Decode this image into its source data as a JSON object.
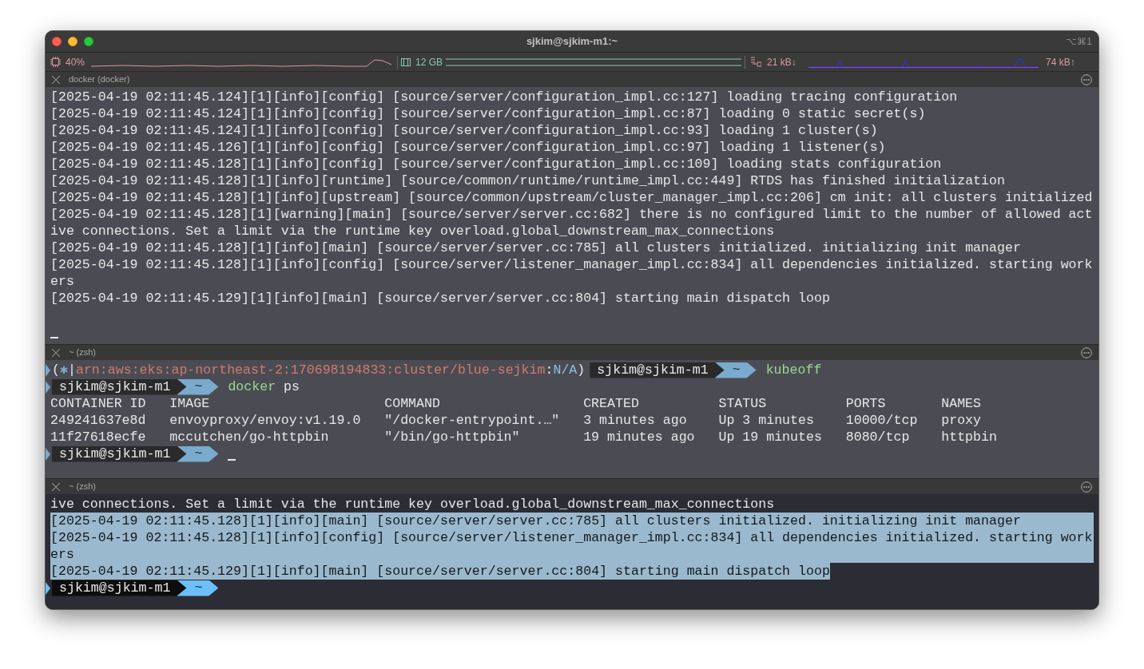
{
  "window": {
    "title": "sjkim@sjkim-m1:~",
    "shortcut": "⌥⌘1"
  },
  "status_bar": {
    "cpu": "40%",
    "memory": "12 GB",
    "download": "21 kB↓",
    "upload": "74 kB↑"
  },
  "panes": [
    {
      "title": "docker (docker)",
      "active": false,
      "lines": [
        {
          "kind": "text",
          "text": "[2025-04-19 02:11:45.124][1][info][config] [source/server/configuration_impl.cc:127] loading tracing configuration"
        },
        {
          "kind": "text",
          "text": "[2025-04-19 02:11:45.124][1][info][config] [source/server/configuration_impl.cc:87] loading 0 static secret(s)"
        },
        {
          "kind": "text",
          "text": "[2025-04-19 02:11:45.124][1][info][config] [source/server/configuration_impl.cc:93] loading 1 cluster(s)"
        },
        {
          "kind": "text",
          "text": "[2025-04-19 02:11:45.126][1][info][config] [source/server/configuration_impl.cc:97] loading 1 listener(s)"
        },
        {
          "kind": "text",
          "text": "[2025-04-19 02:11:45.128][1][info][config] [source/server/configuration_impl.cc:109] loading stats configuration"
        },
        {
          "kind": "text",
          "text": "[2025-04-19 02:11:45.128][1][info][runtime] [source/common/runtime/runtime_impl.cc:449] RTDS has finished initialization"
        },
        {
          "kind": "text",
          "text": "[2025-04-19 02:11:45.128][1][info][upstream] [source/common/upstream/cluster_manager_impl.cc:206] cm init: all clusters initialized"
        },
        {
          "kind": "text",
          "text": "[2025-04-19 02:11:45.128][1][warning][main] [source/server/server.cc:682] there is no configured limit to the number of allowed act"
        },
        {
          "kind": "text",
          "text": "ive connections. Set a limit via the runtime key overload.global_downstream_max_connections"
        },
        {
          "kind": "text",
          "text": "[2025-04-19 02:11:45.128][1][info][main] [source/server/server.cc:785] all clusters initialized. initializing init manager"
        },
        {
          "kind": "text",
          "text": "[2025-04-19 02:11:45.128][1][info][config] [source/server/listener_manager_impl.cc:834] all dependencies initialized. starting work"
        },
        {
          "kind": "text",
          "text": "ers"
        },
        {
          "kind": "text",
          "text": "[2025-04-19 02:11:45.129][1][info][main] [source/server/server.cc:804] starting main dispatch loop"
        },
        {
          "kind": "blank"
        },
        {
          "kind": "cursor"
        }
      ]
    },
    {
      "title": "~ (zsh)",
      "active": false,
      "lines": [
        {
          "kind": "context_prompt",
          "context": {
            "open": "(",
            "icon": "✱",
            "sep": "|",
            "cluster": "arn:aws:eks:ap-northeast-2:170698194833:cluster/blue-sejkim",
            "colon": ":",
            "namespace": "N/A",
            "close": ")"
          },
          "prompt": {
            "user": "sjkim@sjkim-m1",
            "dir": "~",
            "command": "kubeoff"
          }
        },
        {
          "kind": "prompt",
          "prompt": {
            "user": "sjkim@sjkim-m1",
            "dir": "~",
            "command": "docker",
            "args": "ps"
          }
        },
        {
          "kind": "table",
          "columns": [
            "CONTAINER ID",
            "IMAGE",
            "COMMAND",
            "CREATED",
            "STATUS",
            "PORTS",
            "NAMES"
          ],
          "rows": [
            [
              "249241637e8d",
              "envoyproxy/envoy:v1.19.0",
              "\"/docker-entrypoint.…\"",
              "3 minutes ago",
              "Up 3 minutes",
              "10000/tcp",
              "proxy"
            ],
            [
              "11f27618ecfe",
              "mccutchen/go-httpbin",
              "\"/bin/go-httpbin\"",
              "19 minutes ago",
              "Up 19 minutes",
              "8080/tcp",
              "httpbin"
            ]
          ]
        },
        {
          "kind": "prompt",
          "cursor": true,
          "prompt": {
            "user": "sjkim@sjkim-m1",
            "dir": "~"
          }
        }
      ]
    },
    {
      "title": "~ (zsh)",
      "active": true,
      "lines": [
        {
          "kind": "text",
          "selected": false,
          "text": "ive connections. Set a limit via the runtime key overload.global_downstream_max_connections"
        },
        {
          "kind": "text",
          "selected": true,
          "text": "[2025-04-19 02:11:45.128][1][info][main] [source/server/server.cc:785] all clusters initialized. initializing init manager"
        },
        {
          "kind": "text",
          "selected": true,
          "text": "[2025-04-19 02:11:45.128][1][info][config] [source/server/listener_manager_impl.cc:834] all dependencies initialized. starting work"
        },
        {
          "kind": "text",
          "selected": true,
          "text": "ers"
        },
        {
          "kind": "text",
          "selected": true,
          "text": "[2025-04-19 02:11:45.129][1][info][main] [source/server/server.cc:804] starting main dispatch loop"
        },
        {
          "kind": "prompt",
          "prompt": {
            "user": "sjkim@sjkim-m1",
            "dir": "~"
          }
        }
      ]
    }
  ]
}
